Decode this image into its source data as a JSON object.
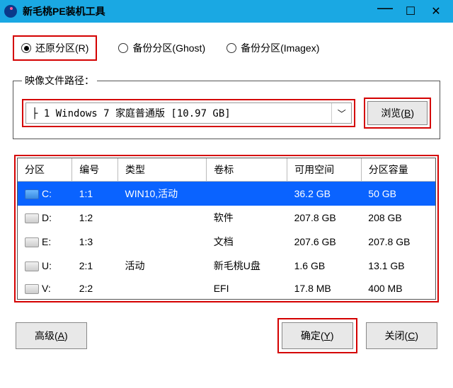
{
  "titlebar": {
    "title": "新毛桃PE装机工具"
  },
  "radios": {
    "restore": "还原分区(R)",
    "backup_ghost": "备份分区(Ghost)",
    "backup_imagex": "备份分区(Imagex)"
  },
  "image_path": {
    "legend": "映像文件路径：",
    "selected": "├ 1 Windows 7 家庭普通版 [10.97 GB]",
    "browse": "浏览(B)"
  },
  "table": {
    "headers": {
      "part": "分区",
      "num": "编号",
      "type": "类型",
      "vol": "卷标",
      "free": "可用空间",
      "size": "分区容量"
    },
    "rows": [
      {
        "part": "C:",
        "num": "1:1",
        "type": "WIN10,活动",
        "vol": "",
        "free": "36.2 GB",
        "size": "50 GB",
        "selected": true
      },
      {
        "part": "D:",
        "num": "1:2",
        "type": "",
        "vol": "软件",
        "free": "207.8 GB",
        "size": "208 GB",
        "selected": false
      },
      {
        "part": "E:",
        "num": "1:3",
        "type": "",
        "vol": "文档",
        "free": "207.6 GB",
        "size": "207.8 GB",
        "selected": false
      },
      {
        "part": "U:",
        "num": "2:1",
        "type": "活动",
        "vol": "新毛桃U盘",
        "free": "1.6 GB",
        "size": "13.1 GB",
        "selected": false
      },
      {
        "part": "V:",
        "num": "2:2",
        "type": "",
        "vol": "EFI",
        "free": "17.8 MB",
        "size": "400 MB",
        "selected": false
      }
    ]
  },
  "buttons": {
    "advanced": "高级(A)",
    "ok": "确定(Y)",
    "close": "关闭(C)"
  }
}
